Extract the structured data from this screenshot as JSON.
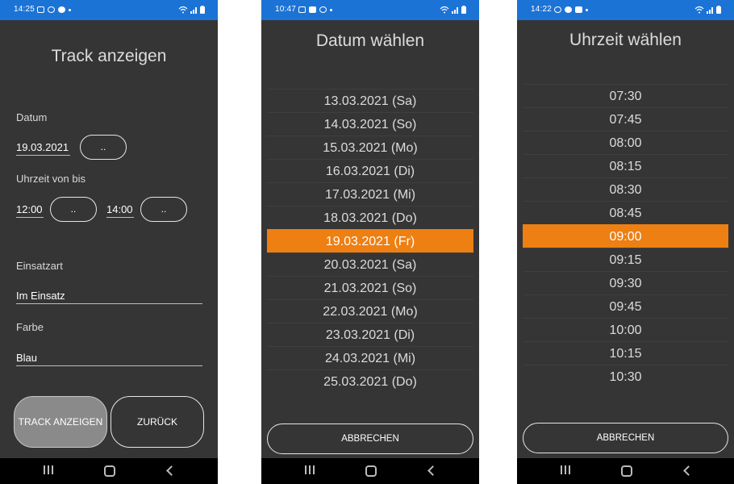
{
  "colors": {
    "accent": "#ee7f12",
    "statusbar": "#1c73d6",
    "background": "#353535"
  },
  "screen1": {
    "status_time": "14:25",
    "title": "Track anzeigen",
    "date_label": "Datum",
    "date_value": "19.03.2021",
    "picker_label": "..",
    "time_label": "Uhrzeit von bis",
    "time_from": "12:00",
    "time_to": "14:00",
    "mission_label": "Einsatzart",
    "mission_value": "Im Einsatz",
    "color_label": "Farbe",
    "color_value": "Blau",
    "show_button": "TRACK ANZEIGEN",
    "back_button": "ZURÜCK"
  },
  "screen2": {
    "status_time": "10:47",
    "title": "Datum wählen",
    "dates": [
      "13.03.2021 (Sa)",
      "14.03.2021 (So)",
      "15.03.2021 (Mo)",
      "16.03.2021 (Di)",
      "17.03.2021 (Mi)",
      "18.03.2021 (Do)",
      "19.03.2021 (Fr)",
      "20.03.2021 (Sa)",
      "21.03.2021 (So)",
      "22.03.2021 (Mo)",
      "23.03.2021 (Di)",
      "24.03.2021 (Mi)",
      "25.03.2021 (Do)"
    ],
    "selected_date": "19.03.2021 (Fr)",
    "cancel_button": "ABBRECHEN"
  },
  "screen3": {
    "status_time": "14:22",
    "title": "Uhrzeit wählen",
    "times": [
      "07:30",
      "07:45",
      "08:00",
      "08:15",
      "08:30",
      "08:45",
      "09:00",
      "09:15",
      "09:30",
      "09:45",
      "10:00",
      "10:15",
      "10:30"
    ],
    "selected_time": "09:00",
    "cancel_button": "ABBRECHEN"
  }
}
